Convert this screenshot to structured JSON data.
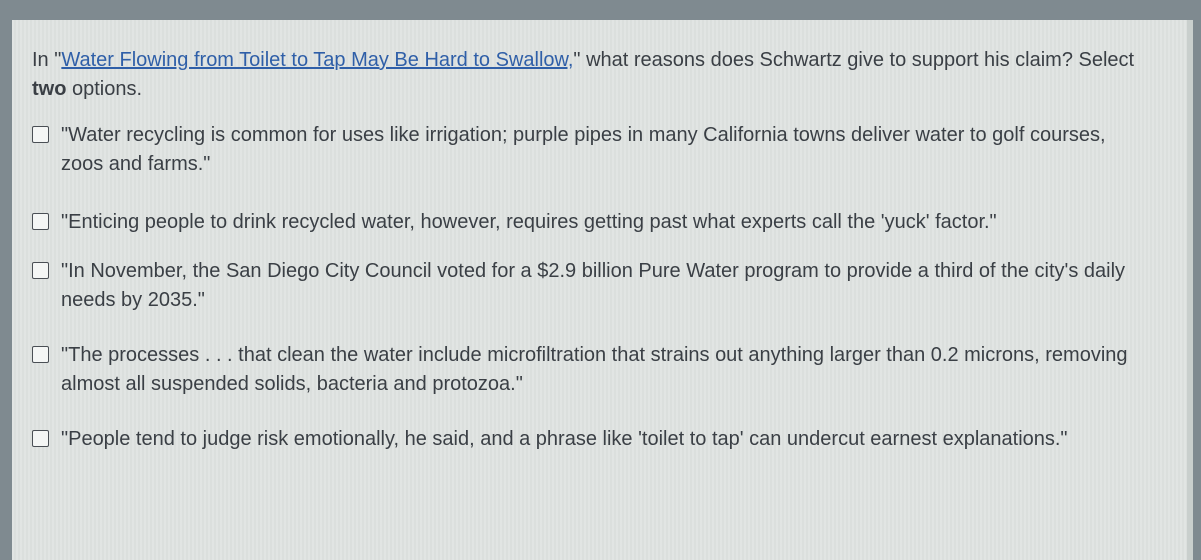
{
  "question": {
    "prefix": "In \"",
    "link_text": "Water Flowing from Toilet to Tap May Be Hard to Swallow,",
    "after_link": "\" what reasons does Schwartz give to support his claim? Select ",
    "emphasis": "two",
    "suffix": " options."
  },
  "options": [
    {
      "text": "\"Water recycling is common for uses like irrigation; purple pipes in many California towns deliver water to golf courses, zoos and farms.\"",
      "checked": false
    },
    {
      "text": "\"Enticing people to drink recycled water, however, requires getting past what experts call the 'yuck' factor.\"",
      "checked": false
    },
    {
      "text": "\"In November, the San Diego City Council voted for a $2.9 billion Pure Water program to provide a third of the city's daily needs by 2035.\"",
      "checked": false
    },
    {
      "text": "\"The processes . . . that clean the water include microfiltration that strains out anything larger than 0.2 microns, removing almost all suspended solids, bacteria and protozoa.\"",
      "checked": false
    },
    {
      "text": "\"People tend to judge risk emotionally, he said, and a phrase like 'toilet to tap' can undercut earnest explanations.\"",
      "checked": false
    }
  ],
  "colors": {
    "background": "#7f8a90",
    "panel": "#dfe3e1",
    "text": "#3a3f45",
    "link": "#2f5fa8"
  }
}
